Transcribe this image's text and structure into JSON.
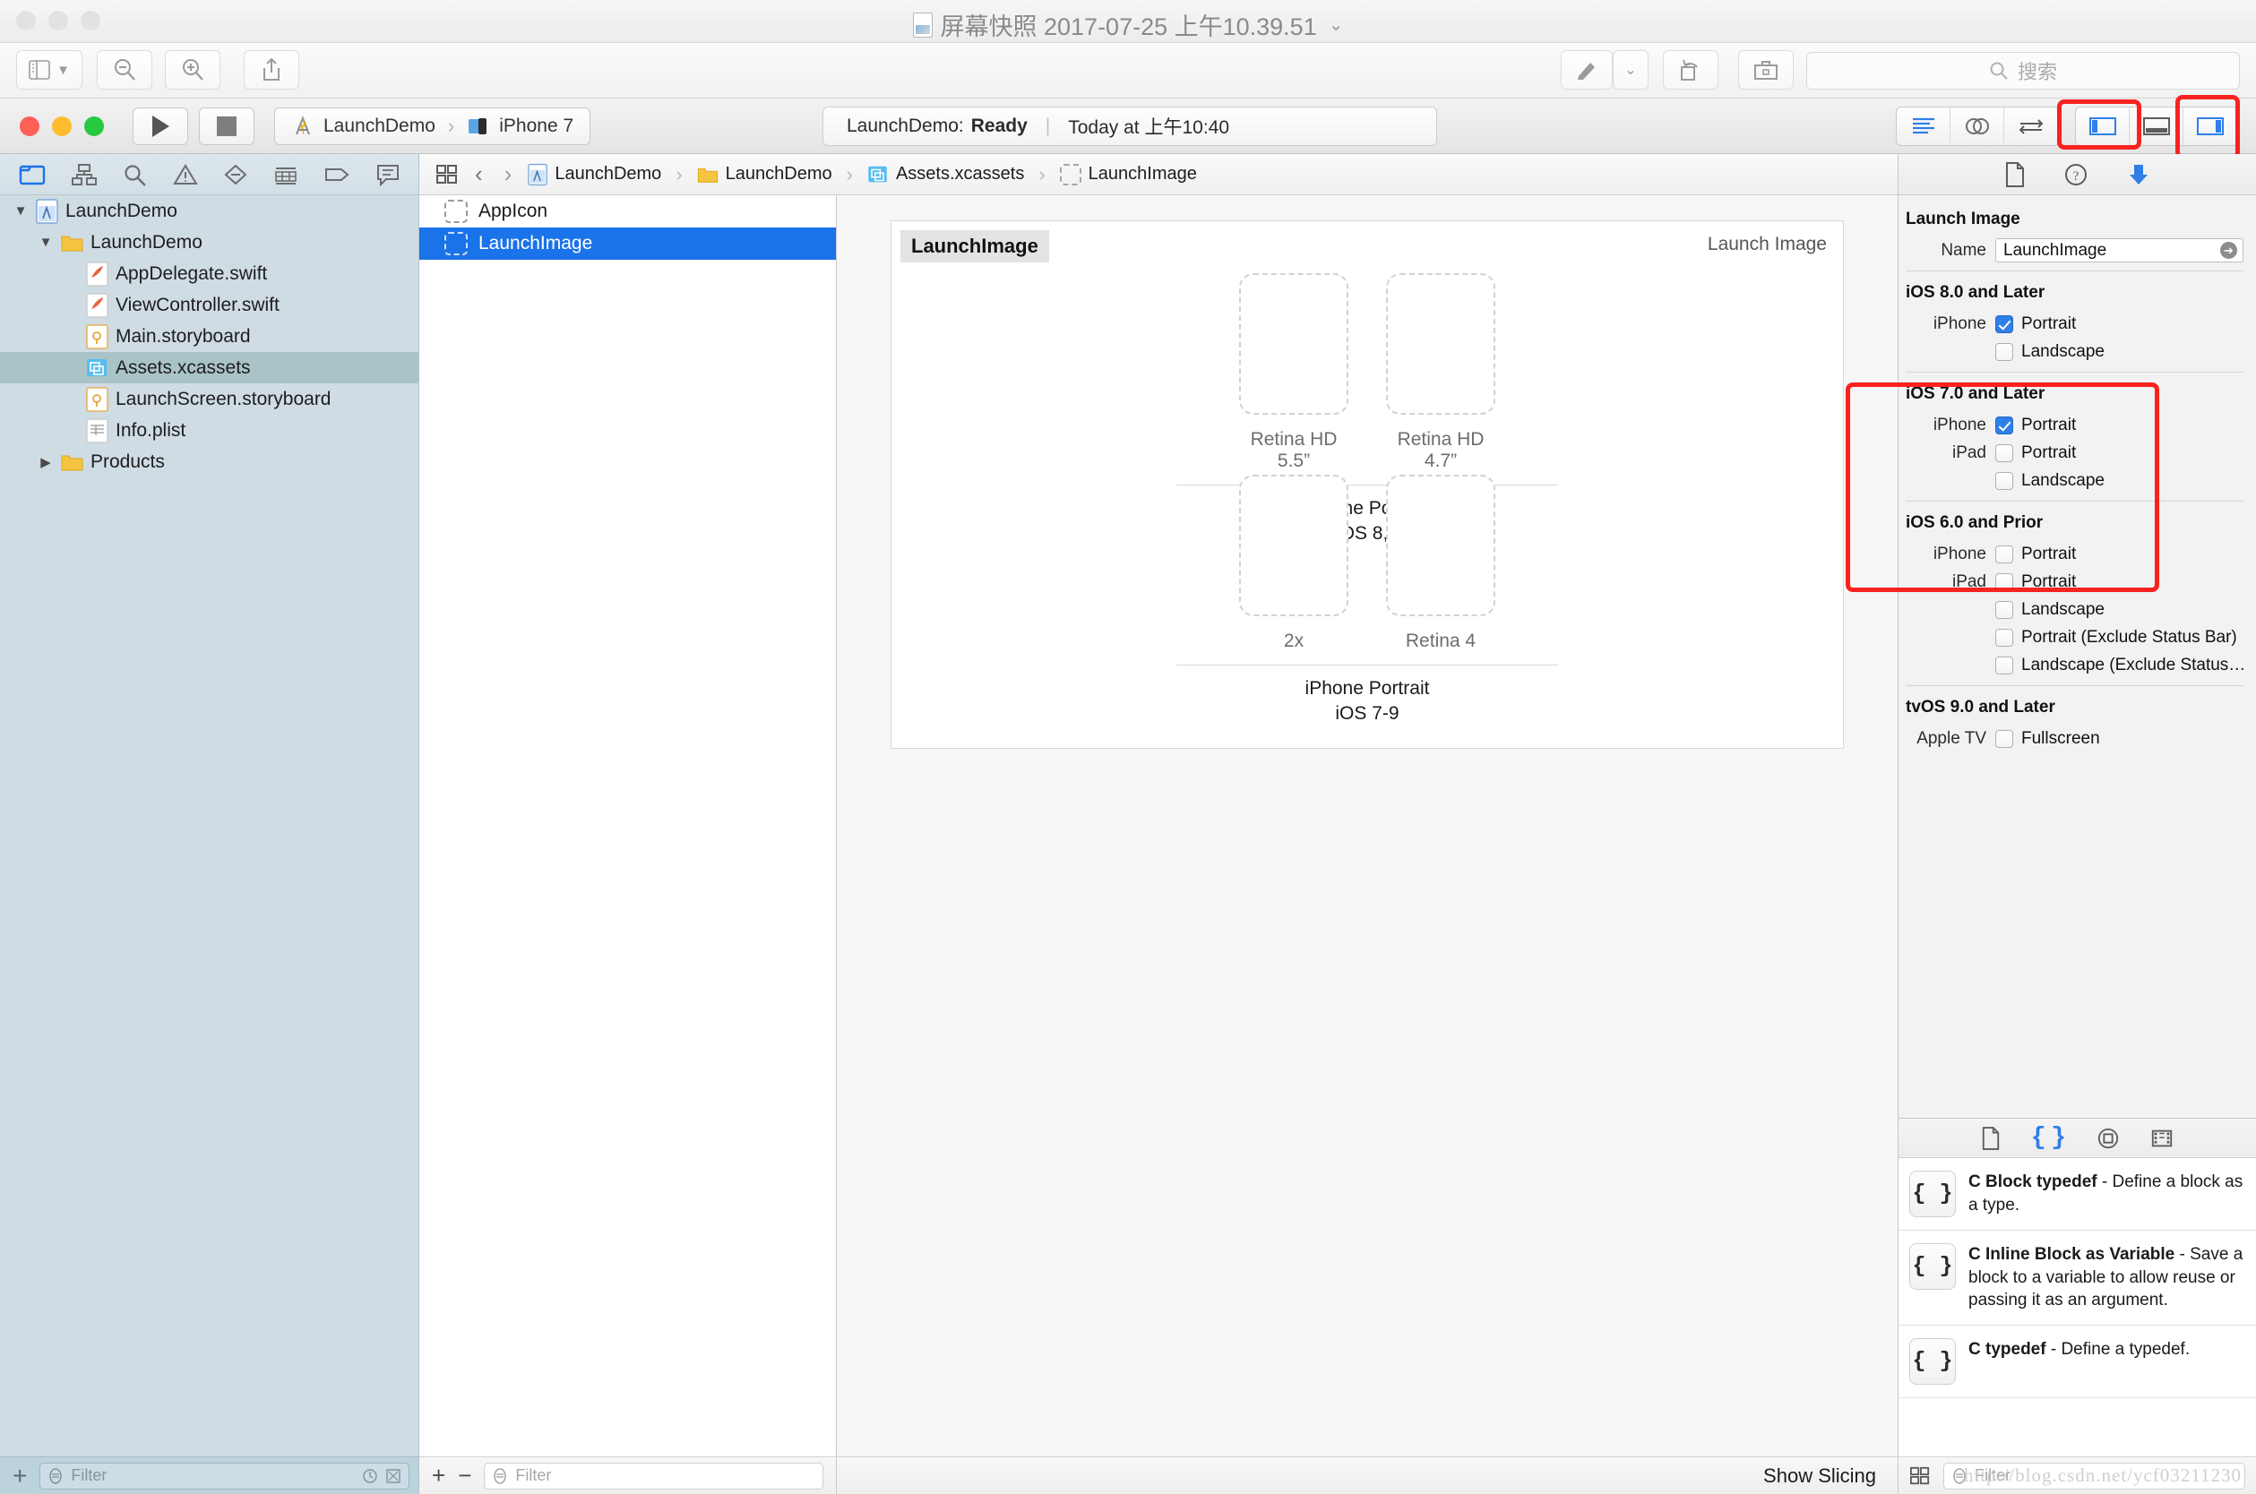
{
  "preview_window": {
    "title": "屏幕快照 2017-07-25 上午10.39.51",
    "toolbar": {
      "sidebar_label": "sidebar-toggle",
      "zoom_out_label": "zoom-out",
      "zoom_in_label": "zoom-in",
      "share_label": "share",
      "markup_label": "markup",
      "rotate_label": "rotate",
      "toolbox_label": "toolbox"
    },
    "search_placeholder": "搜索"
  },
  "xcode": {
    "toolbar": {
      "run_label": "Run",
      "stop_label": "Stop",
      "scheme": "LaunchDemo",
      "destination": "iPhone 7",
      "status_project": "LaunchDemo:",
      "status_state": "Ready",
      "status_divider": "|",
      "status_time": "Today at 上午10:40"
    },
    "navigator": {
      "tabs": [
        "project-navigator",
        "symbol-navigator",
        "find-navigator",
        "issue-navigator",
        "test-navigator",
        "report-navigator",
        "tag-navigator",
        "comment-navigator"
      ],
      "tree": [
        {
          "label": "LaunchDemo",
          "indent": 0,
          "icon": "xcodeproj",
          "disclosure": "down",
          "selected": false
        },
        {
          "label": "LaunchDemo",
          "indent": 1,
          "icon": "folder",
          "disclosure": "down",
          "selected": false
        },
        {
          "label": "AppDelegate.swift",
          "indent": 2,
          "icon": "swift",
          "disclosure": "",
          "selected": false
        },
        {
          "label": "ViewController.swift",
          "indent": 2,
          "icon": "swift",
          "disclosure": "",
          "selected": false
        },
        {
          "label": "Main.storyboard",
          "indent": 2,
          "icon": "storyboard",
          "disclosure": "",
          "selected": false
        },
        {
          "label": "Assets.xcassets",
          "indent": 2,
          "icon": "xcassets",
          "disclosure": "",
          "selected": true
        },
        {
          "label": "LaunchScreen.storyboard",
          "indent": 2,
          "icon": "storyboard",
          "disclosure": "",
          "selected": false
        },
        {
          "label": "Info.plist",
          "indent": 2,
          "icon": "plist",
          "disclosure": "",
          "selected": false
        },
        {
          "label": "Products",
          "indent": 1,
          "icon": "folder",
          "disclosure": "right",
          "selected": false
        }
      ],
      "filter_placeholder": "Filter",
      "add_label": "+"
    },
    "jumpbar": {
      "back_label": "‹",
      "forward_label": "›",
      "crumbs": [
        {
          "label": "LaunchDemo",
          "icon": "xcodeproj"
        },
        {
          "label": "LaunchDemo",
          "icon": "folder"
        },
        {
          "label": "Assets.xcassets",
          "icon": "xcassets"
        },
        {
          "label": "LaunchImage",
          "icon": "imageset"
        }
      ]
    },
    "asset_list": {
      "items": [
        {
          "label": "AppIcon",
          "selected": false
        },
        {
          "label": "LaunchImage",
          "selected": true
        }
      ],
      "add_label": "+",
      "remove_label": "−",
      "filter_placeholder": "Filter"
    },
    "editor": {
      "card_title": "LaunchImage",
      "card_kind": "Launch Image",
      "groups": [
        {
          "slots": [
            {
              "label": "Retina HD 5.5”"
            },
            {
              "label": "Retina HD 4.7”"
            }
          ],
          "name_line1": "iPhone Portrait",
          "name_line2": "iOS 8,9"
        },
        {
          "slots": [
            {
              "label": "2x"
            },
            {
              "label": "Retina 4"
            }
          ],
          "name_line1": "iPhone Portrait",
          "name_line2": "iOS 7-9"
        }
      ],
      "show_slicing": "Show Slicing"
    },
    "inspector": {
      "tabs": [
        "file-inspector",
        "quick-help-inspector",
        "attributes-inspector"
      ],
      "selected_tab": "attributes-inspector",
      "title": "Launch Image",
      "name_label": "Name",
      "name_value": "LaunchImage",
      "sections": [
        {
          "heading": "iOS 8.0 and Later",
          "highlighted": true,
          "rows": [
            {
              "device": "iPhone",
              "label": "Portrait",
              "checked": true
            },
            {
              "device": "",
              "label": "Landscape",
              "checked": false
            }
          ]
        },
        {
          "heading": "iOS 7.0 and Later",
          "highlighted": true,
          "rows": [
            {
              "device": "iPhone",
              "label": "Portrait",
              "checked": true
            },
            {
              "device": "iPad",
              "label": "Portrait",
              "checked": false
            },
            {
              "device": "",
              "label": "Landscape",
              "checked": false
            }
          ]
        },
        {
          "heading": "iOS 6.0 and Prior",
          "highlighted": false,
          "rows": [
            {
              "device": "iPhone",
              "label": "Portrait",
              "checked": false
            },
            {
              "device": "iPad",
              "label": "Portrait",
              "checked": false
            },
            {
              "device": "",
              "label": "Landscape",
              "checked": false
            },
            {
              "device": "",
              "label": "Portrait (Exclude Status Bar)",
              "checked": false
            },
            {
              "device": "",
              "label": "Landscape (Exclude Status…",
              "checked": false
            }
          ]
        },
        {
          "heading": "tvOS 9.0 and Later",
          "highlighted": false,
          "rows": [
            {
              "device": "Apple TV",
              "label": "Fullscreen",
              "checked": false
            }
          ]
        }
      ]
    },
    "library": {
      "tabs": [
        "file-template-library",
        "code-snippet-library",
        "object-library",
        "media-library"
      ],
      "selected_tab": "code-snippet-library",
      "items": [
        {
          "icon": "{ }",
          "title": "C Block typedef",
          "desc": "- Define a block as a type."
        },
        {
          "icon": "{ }",
          "title": "C Inline Block as Variable",
          "desc": "- Save a block to a variable to allow reuse or passing it as an argument."
        },
        {
          "icon": "{ }",
          "title": "C typedef",
          "desc": "- Define a typedef."
        }
      ],
      "filter_placeholder": "Filter"
    }
  },
  "watermark": "http://blog.csdn.net/ycf03211230",
  "colors": {
    "accent_blue": "#1a73e8",
    "annotation_red": "#f8221f",
    "navigator_bg": "#cfdce4",
    "selection_green": "#a9c3c6"
  }
}
